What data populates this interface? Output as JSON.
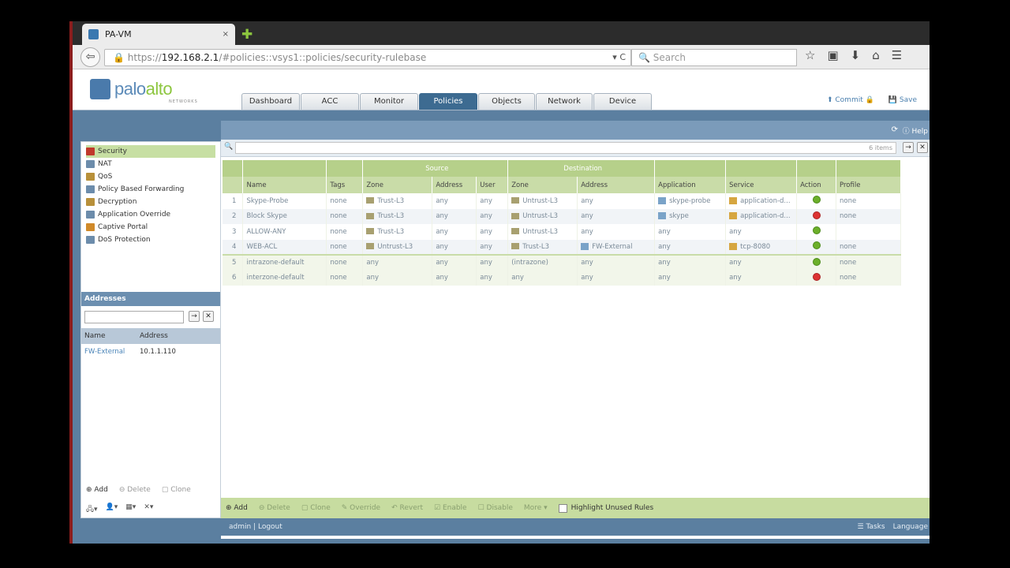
{
  "browser": {
    "tab_title": "PA-VM",
    "tab_close": "×",
    "new_tab": "✚",
    "url_host": "192.168.2.1",
    "url_prefix": "https://",
    "url_path": "/#policies::vsys1::policies/security-rulebase",
    "search_placeholder": "Search",
    "url_controls": "▾ C"
  },
  "header": {
    "logo_text_a": "palo",
    "logo_text_b": "alto",
    "logo_sub": "NETWORKS",
    "tabs": [
      "Dashboard",
      "ACC",
      "Monitor",
      "Policies",
      "Objects",
      "Network",
      "Device"
    ],
    "active_tab": "Policies",
    "commit_label": "Commit",
    "save_label": "Save"
  },
  "toolbar": {
    "refresh_label": "⟳",
    "help_label": "Help"
  },
  "sidebar": {
    "items": [
      "Security",
      "NAT",
      "QoS",
      "Policy Based Forwarding",
      "Decryption",
      "Application Override",
      "Captive Portal",
      "DoS Protection"
    ],
    "selected": "Security",
    "addresses_title": "Addresses",
    "addr_columns": [
      "Name",
      "Address"
    ],
    "addr_rows": [
      {
        "name": "FW-External",
        "address": "10.1.1.110"
      }
    ],
    "actions": [
      "Add",
      "Delete",
      "Clone"
    ]
  },
  "filter": {
    "count_text": "6 items"
  },
  "rules": {
    "group_headers": {
      "source": "Source",
      "destination": "Destination"
    },
    "columns": [
      "",
      "Name",
      "Tags",
      "Zone",
      "Address",
      "User",
      "Zone",
      "Address",
      "Application",
      "Service",
      "Action",
      "Profile"
    ],
    "rows": [
      {
        "num": "1",
        "name": "Skype-Probe",
        "tags": "none",
        "src_zone": "Trust-L3",
        "src_addr": "any",
        "user": "any",
        "dst_zone": "Untrust-L3",
        "dst_addr": "any",
        "app": "skype-probe",
        "service": "application-d...",
        "action": "allow",
        "profile": "none"
      },
      {
        "num": "2",
        "name": "Block Skype",
        "tags": "none",
        "src_zone": "Trust-L3",
        "src_addr": "any",
        "user": "any",
        "dst_zone": "Untrust-L3",
        "dst_addr": "any",
        "app": "skype",
        "service": "application-d...",
        "action": "deny",
        "profile": "none"
      },
      {
        "num": "3",
        "name": "ALLOW-ANY",
        "tags": "none",
        "src_zone": "Trust-L3",
        "src_addr": "any",
        "user": "any",
        "dst_zone": "Untrust-L3",
        "dst_addr": "any",
        "app": "any",
        "service": "any",
        "action": "allow",
        "profile": ""
      },
      {
        "num": "4",
        "name": "WEB-ACL",
        "tags": "none",
        "src_zone": "Untrust-L3",
        "src_addr": "any",
        "user": "any",
        "dst_zone": "Trust-L3",
        "dst_addr": "FW-External",
        "app": "any",
        "service": "tcp-8080",
        "action": "allow",
        "profile": "none"
      },
      {
        "num": "5",
        "name": "intrazone-default",
        "tags": "none",
        "src_zone": "any",
        "src_addr": "any",
        "user": "any",
        "dst_zone": "(intrazone)",
        "dst_addr": "any",
        "app": "any",
        "service": "any",
        "action": "allow",
        "profile": "none"
      },
      {
        "num": "6",
        "name": "interzone-default",
        "tags": "none",
        "src_zone": "any",
        "src_addr": "any",
        "user": "any",
        "dst_zone": "any",
        "dst_addr": "any",
        "app": "any",
        "service": "any",
        "action": "deny",
        "profile": "none"
      }
    ]
  },
  "bottombar": {
    "actions": [
      "Add",
      "Delete",
      "Clone",
      "Override",
      "Revert",
      "Enable",
      "Disable",
      "More ▾"
    ],
    "highlight_label": "Highlight Unused Rules"
  },
  "statusbar": {
    "user": "admin",
    "logout": "Logout",
    "tasks": "Tasks",
    "language": "Language"
  }
}
